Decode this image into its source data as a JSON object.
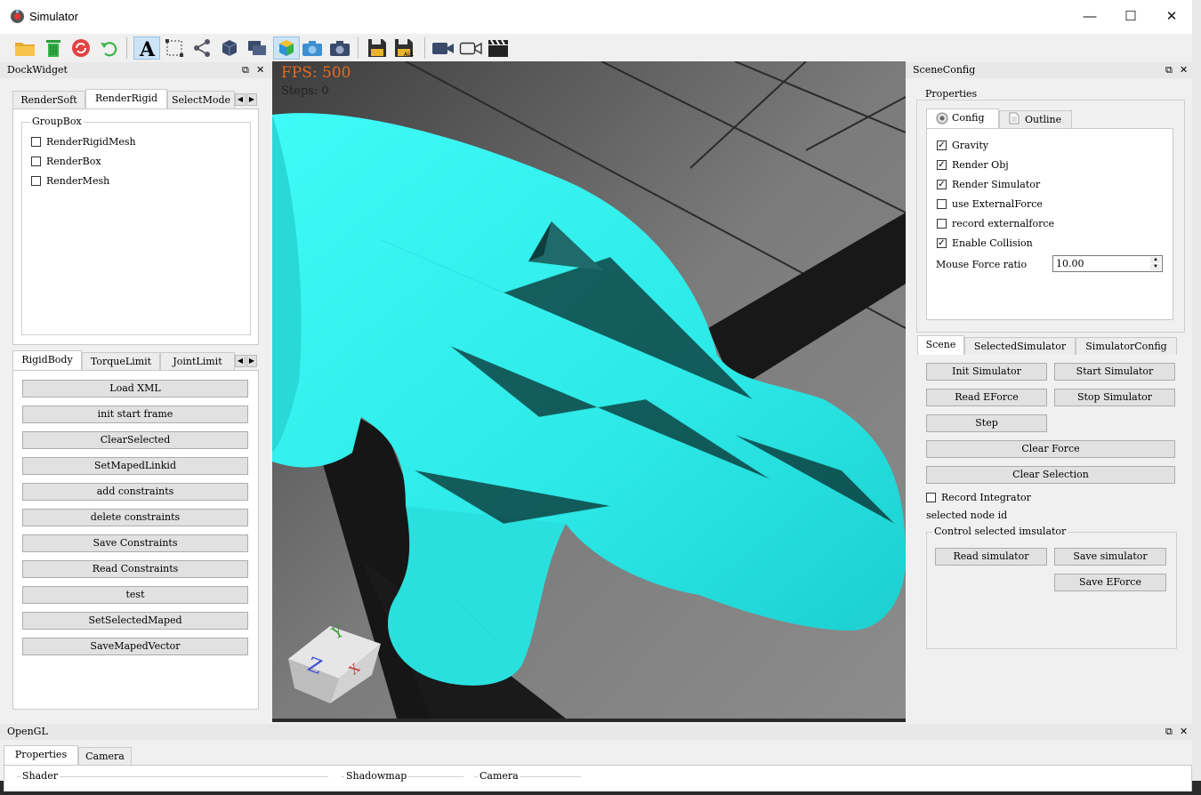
{
  "window": {
    "title": "Simulator",
    "minimize": "—",
    "maximize": "☐",
    "close": "✕"
  },
  "toolbar": {
    "icons": [
      "open-folder-icon",
      "trash-icon",
      "reload-icon",
      "undo-icon",
      "text-A-icon",
      "select-rect-icon",
      "share-icon",
      "cube-icon",
      "layers-icon",
      "colored-cube-icon",
      "camera-icon",
      "camera2-icon",
      "save-icon",
      "save-all-icon",
      "video-camera-icon",
      "video-outline-icon",
      "clapperboard-icon"
    ]
  },
  "left_dock": {
    "title": "DockWidget",
    "top_tabs": [
      "RenderSoft",
      "RenderRigid",
      "SelectMode"
    ],
    "group_title": "GroupBox",
    "checks": [
      {
        "label": "RenderRigidMesh",
        "checked": false
      },
      {
        "label": "RenderBox",
        "checked": false
      },
      {
        "label": "RenderMesh",
        "checked": false
      }
    ],
    "bottom_tabs": [
      "RigidBody",
      "TorqueLimit",
      "JointLimit"
    ],
    "buttons": [
      "Load XML",
      "init start frame",
      "ClearSelected",
      "SetMapedLinkid",
      "add constraints",
      "delete constraints",
      "Save Constraints",
      "Read Constraints",
      "test",
      "SetSelectedMaped",
      "SaveMapedVector"
    ]
  },
  "viewport": {
    "fps": "FPS: 500",
    "steps": "Steps: 0",
    "axis": {
      "x": "X",
      "y": "Y",
      "z": "Z"
    },
    "mesh_color": "#2cf2f0"
  },
  "right_dock": {
    "title": "SceneConfig",
    "properties_title": "Properties",
    "tabs": [
      "Config",
      "Outline"
    ],
    "checks": [
      {
        "label": "Gravity",
        "checked": true
      },
      {
        "label": "Render Obj",
        "checked": true
      },
      {
        "label": "Render Simulator",
        "checked": true
      },
      {
        "label": "use ExternalForce",
        "checked": false
      },
      {
        "label": "record externalforce",
        "checked": false
      },
      {
        "label": "Enable Collision",
        "checked": true
      }
    ],
    "mouse_force_label": "Mouse Force ratio",
    "mouse_force_value": "10.00",
    "scene_tabs": [
      "Scene",
      "SelectedSimulator",
      "SimulatorConfig"
    ],
    "buttons": {
      "init": "Init Simulator",
      "start": "Start Simulator",
      "read_eforce": "Read EForce",
      "stop": "Stop Simulator",
      "step": "Step",
      "clear_force": "Clear Force",
      "clear_selection": "Clear Selection"
    },
    "record_integrator": "Record Integrator",
    "selected_node": "selected node id",
    "control_group": "Control selected imsulator",
    "control_buttons": {
      "read": "Read simulator",
      "save": "Save simulator",
      "save_eforce": "Save EForce"
    }
  },
  "bottom_dock": {
    "title": "OpenGL",
    "tabs": [
      "Properties",
      "Camera"
    ],
    "groups": [
      "Shader",
      "Shadowmap",
      "Camera"
    ]
  },
  "checkmark": "✓"
}
